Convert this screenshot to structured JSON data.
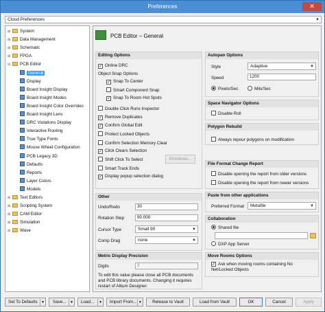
{
  "window": {
    "title": "Preferences",
    "close_glyph": "✕"
  },
  "search": {
    "value": "Cloud Preferences"
  },
  "tree": {
    "items": [
      {
        "label": "System",
        "toggle": "⊞",
        "kind": "folder"
      },
      {
        "label": "Data Management",
        "toggle": "⊞",
        "kind": "folder"
      },
      {
        "label": "Schematic",
        "toggle": "⊞",
        "kind": "folder"
      },
      {
        "label": "FPGA",
        "toggle": "⊞",
        "kind": "folder"
      },
      {
        "label": "PCB Editor",
        "toggle": "⊟",
        "kind": "folder"
      },
      {
        "label": "General",
        "toggle": "",
        "kind": "page"
      },
      {
        "label": "Display",
        "toggle": "",
        "kind": "page"
      },
      {
        "label": "Board Insight Display",
        "toggle": "",
        "kind": "page"
      },
      {
        "label": "Board Insight Modes",
        "toggle": "",
        "kind": "page"
      },
      {
        "label": "Board Insight Color Overrides",
        "toggle": "",
        "kind": "page"
      },
      {
        "label": "Board Insight Lens",
        "toggle": "",
        "kind": "page"
      },
      {
        "label": "DRC Violations Display",
        "toggle": "",
        "kind": "page"
      },
      {
        "label": "Interactive Routing",
        "toggle": "",
        "kind": "page"
      },
      {
        "label": "True Type Fonts",
        "toggle": "",
        "kind": "page"
      },
      {
        "label": "Mouse Wheel Configuration",
        "toggle": "",
        "kind": "page"
      },
      {
        "label": "PCB Legacy 3D",
        "toggle": "",
        "kind": "page"
      },
      {
        "label": "Defaults",
        "toggle": "",
        "kind": "page"
      },
      {
        "label": "Reports",
        "toggle": "",
        "kind": "page"
      },
      {
        "label": "Layer Colors",
        "toggle": "",
        "kind": "page"
      },
      {
        "label": "Models",
        "toggle": "",
        "kind": "page"
      },
      {
        "label": "Text Editors",
        "toggle": "⊞",
        "kind": "folder"
      },
      {
        "label": "Scripting System",
        "toggle": "⊞",
        "kind": "folder"
      },
      {
        "label": "CAM Editor",
        "toggle": "⊞",
        "kind": "folder"
      },
      {
        "label": "Simulation",
        "toggle": "⊞",
        "kind": "folder"
      },
      {
        "label": "Wave",
        "toggle": "⊞",
        "kind": "folder"
      }
    ],
    "selected": "General"
  },
  "page": {
    "header": "PCB Editor – General"
  },
  "editing": {
    "title": "Editing Options",
    "online_drc": "Online DRC",
    "snap_header": "Object Snap Options",
    "snap_to_center": "Snap To Center",
    "smart_component_snap": "Smart Component Snap",
    "snap_to_room_hot_spots": "Snap To Room Hot Spots",
    "double_click": "Double Click Runs Inspector",
    "remove_duplicates": "Remove Duplicates",
    "confirm_global_edit": "Confirm Global Edit",
    "protect_locked": "Protect Locked Objects",
    "confirm_selection_memory_clear": "Confirm Selection Memory Clear",
    "click_clears_selection": "Click Clears Selection",
    "shift_click_to_select": "Shift Click To Select",
    "primitives_button": "Primitives...",
    "smart_track_ends": "Smart Track Ends",
    "display_popup": "Display popup selection dialog",
    "check": "✓"
  },
  "other": {
    "title": "Other",
    "undo_redo_label": "Undo/Redo",
    "undo_redo_value": "30",
    "rotation_step_label": "Rotation Step",
    "rotation_step_value": "90.000",
    "cursor_type_label": "Cursor Type",
    "cursor_type_value": "Small 90",
    "comp_drag_label": "Comp Drag",
    "comp_drag_value": "none"
  },
  "metric": {
    "title": "Metric Display Precision",
    "digits_label": "Digits",
    "digits_value": "3",
    "note": "To edit this value please close all PCB documents and PCB library documents. Changing it requires restart of Altium Designer."
  },
  "autopan": {
    "title": "Autopan Options",
    "style_label": "Style",
    "style_value": "Adaptive",
    "speed_label": "Speed",
    "speed_value": "1200",
    "pixels_sec": "Pixels/Sec",
    "mils_sec": "Mils/Sec"
  },
  "space_nav": {
    "title": "Space Navigator Options",
    "disable_roll": "Disable Roll"
  },
  "polygon": {
    "title": "Polygon Rebuild",
    "repour": "Always repour polygons on modification"
  },
  "file_format": {
    "title": "File Format Change Report",
    "older": "Disable opening the report from older versions",
    "newer": "Disable opening the report from newer versions"
  },
  "paste": {
    "title": "Paste from other applications",
    "preferred_label": "Preferred Format",
    "preferred_value": "Metafile"
  },
  "collab": {
    "title": "Collaboration",
    "shared_file": "Shared file",
    "dxp_app_server": "DXP App Server"
  },
  "move_rooms": {
    "title": "Move Rooms Options",
    "ask": "Ask when moving rooms containing No Net/Locked Objects"
  },
  "footer": {
    "set_to_defaults": "Set To Defaults",
    "save": "Save...",
    "load": "Load...",
    "import_from": "Import From...",
    "release_to_vault": "Release to Vault",
    "load_from_vault": "Load from Vault",
    "ok": "OK",
    "cancel": "Cancel",
    "apply": "Apply",
    "dropdown_glyph": "▼"
  }
}
